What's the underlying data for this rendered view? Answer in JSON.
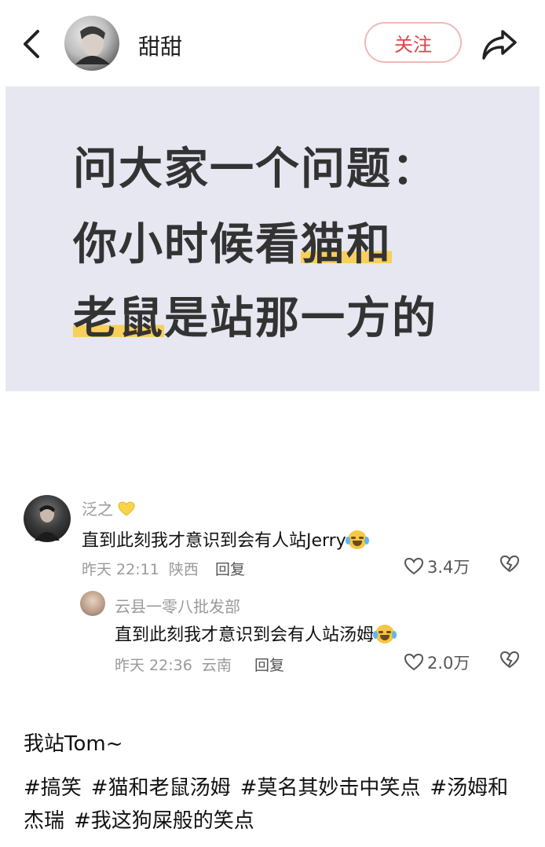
{
  "header": {
    "username": "甜甜",
    "follow_label": "关注"
  },
  "post": {
    "question_lines": [
      {
        "before": "问大家一个问题：",
        "highlight": "",
        "after": ""
      },
      {
        "before": "你小时候看",
        "highlight": "猫和",
        "after": ""
      },
      {
        "before": "",
        "highlight": "老鼠",
        "after": "是站那一方的"
      }
    ],
    "highlight_color": "#f7cf5b",
    "card_bg": "#e7e7f2"
  },
  "comments": [
    {
      "name": "泛之",
      "text": "直到此刻我才意识到会有人站Jerry",
      "time": "昨天 22:11",
      "location": "陕西",
      "reply_label": "回复",
      "likes": "3.4万"
    },
    {
      "name": "云县一零八批发部",
      "text": "直到此刻我才意识到会有人站汤姆",
      "time": "昨天 22:36",
      "location": "云南",
      "reply_label": "回复",
      "likes": "2.0万"
    }
  ],
  "caption": "我站Tom~",
  "tags": [
    "#搞笑",
    "#猫和老鼠汤姆",
    "#莫名其妙击中笑点",
    "#汤姆和杰瑞",
    "#我这狗屎般的笑点"
  ],
  "accent": "#e1434b"
}
